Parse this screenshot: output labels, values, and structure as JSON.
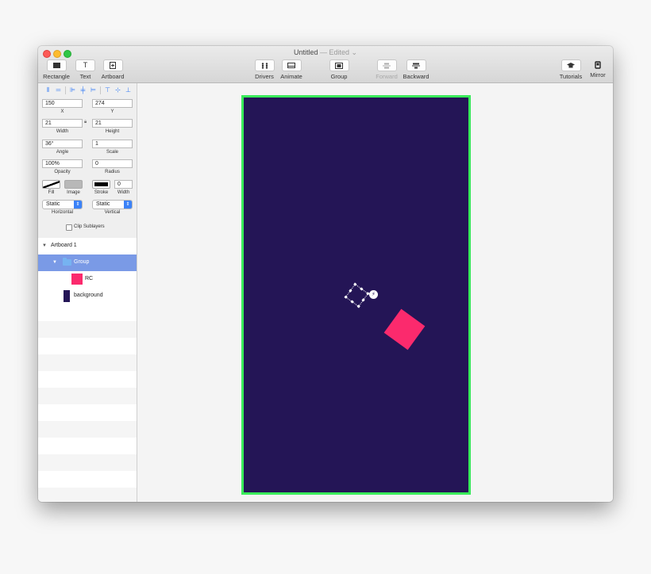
{
  "window": {
    "title": "Untitled",
    "edited": " — Edited ⌄"
  },
  "toolbar": {
    "rectangle": "Rectangle",
    "text": "Text",
    "artboard": "Artboard",
    "drivers": "Drivers",
    "animate": "Animate",
    "group": "Group",
    "forward": "Forward",
    "backward": "Backward",
    "tutorials": "Tutorials",
    "mirror": "Mirror",
    "text_glyph": "T"
  },
  "inspector": {
    "x_value": "150",
    "x_label": "X",
    "y_value": "274",
    "y_label": "Y",
    "width_value": "21",
    "width_label": "Width",
    "height_value": "21",
    "height_label": "Height",
    "angle_value": "36°",
    "angle_label": "Angle",
    "scale_value": "1",
    "scale_label": "Scale",
    "opacity_value": "100%",
    "opacity_label": "Opacity",
    "radius_value": "0",
    "radius_label": "Radius",
    "fill_label": "Fill",
    "image_label": "Image",
    "stroke_label": "Stroke",
    "stroke_width_value": "0",
    "stroke_width_label": "Width",
    "horizontal_value": "Static",
    "horizontal_label": "Horizontal",
    "vertical_value": "Static",
    "vertical_label": "Vertical",
    "clip_sublayers_label": "Clip Sublayers"
  },
  "layers": {
    "artboard": "Artboard 1",
    "group": "Group",
    "rc": "RC",
    "background": "background"
  },
  "colors": {
    "artboard_bg": "#241556",
    "artboard_border": "#39eb5a",
    "rc_fill": "#fb2a6d",
    "selection": "#7a9ae6",
    "accent": "#3b82f7"
  }
}
